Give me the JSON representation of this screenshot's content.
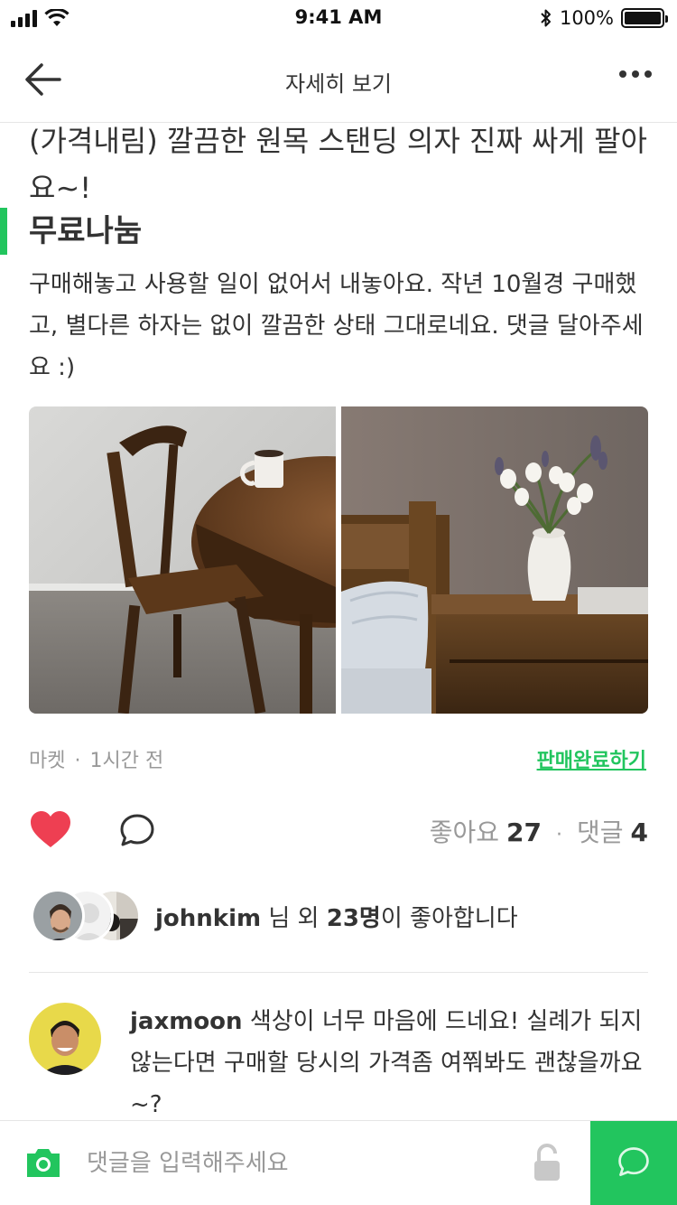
{
  "status_bar": {
    "time": "9:41 AM",
    "battery_percent": "100%",
    "battery_level": 1.0
  },
  "nav": {
    "title": "자세히 보기",
    "back_icon": "back-arrow-icon",
    "more_icon": "more-dots-icon"
  },
  "post": {
    "title": "(가격내림) 깔끔한 원목 스탠딩 의자 진짜 싸게 팔아요~!",
    "price": "무료나눔",
    "description": "구매해놓고 사용할 일이 없어서 내놓아요. 작년 10월경 구매했고, 별다른 하자는 없이 깔끔한 상태 그대로네요. 댓글 달아주세요 :)",
    "category": "마켓",
    "separator": "·",
    "time_ago": "1시간 전",
    "sold_link": "판매완료하기"
  },
  "actions": {
    "like_label": "좋아요",
    "like_count": "27",
    "separator": "·",
    "comment_label": "댓글",
    "comment_count": "4"
  },
  "likers": {
    "username": "johnkim",
    "text_mid": " 님 외 ",
    "others": "23명",
    "text_end": "이 좋아합니다"
  },
  "comments": [
    {
      "username": "jaxmoon",
      "text": " 색상이 너무 마음에 드네요! 실례가 되지 않는다면 구매할 당시의 가격좀 여쭤봐도 괜찮을까요~?"
    }
  ],
  "composer": {
    "placeholder": "댓글을 입력해주세요"
  },
  "colors": {
    "accent": "#22c55e",
    "heart": "#ee3f52",
    "text": "#333333",
    "muted": "#999999"
  }
}
